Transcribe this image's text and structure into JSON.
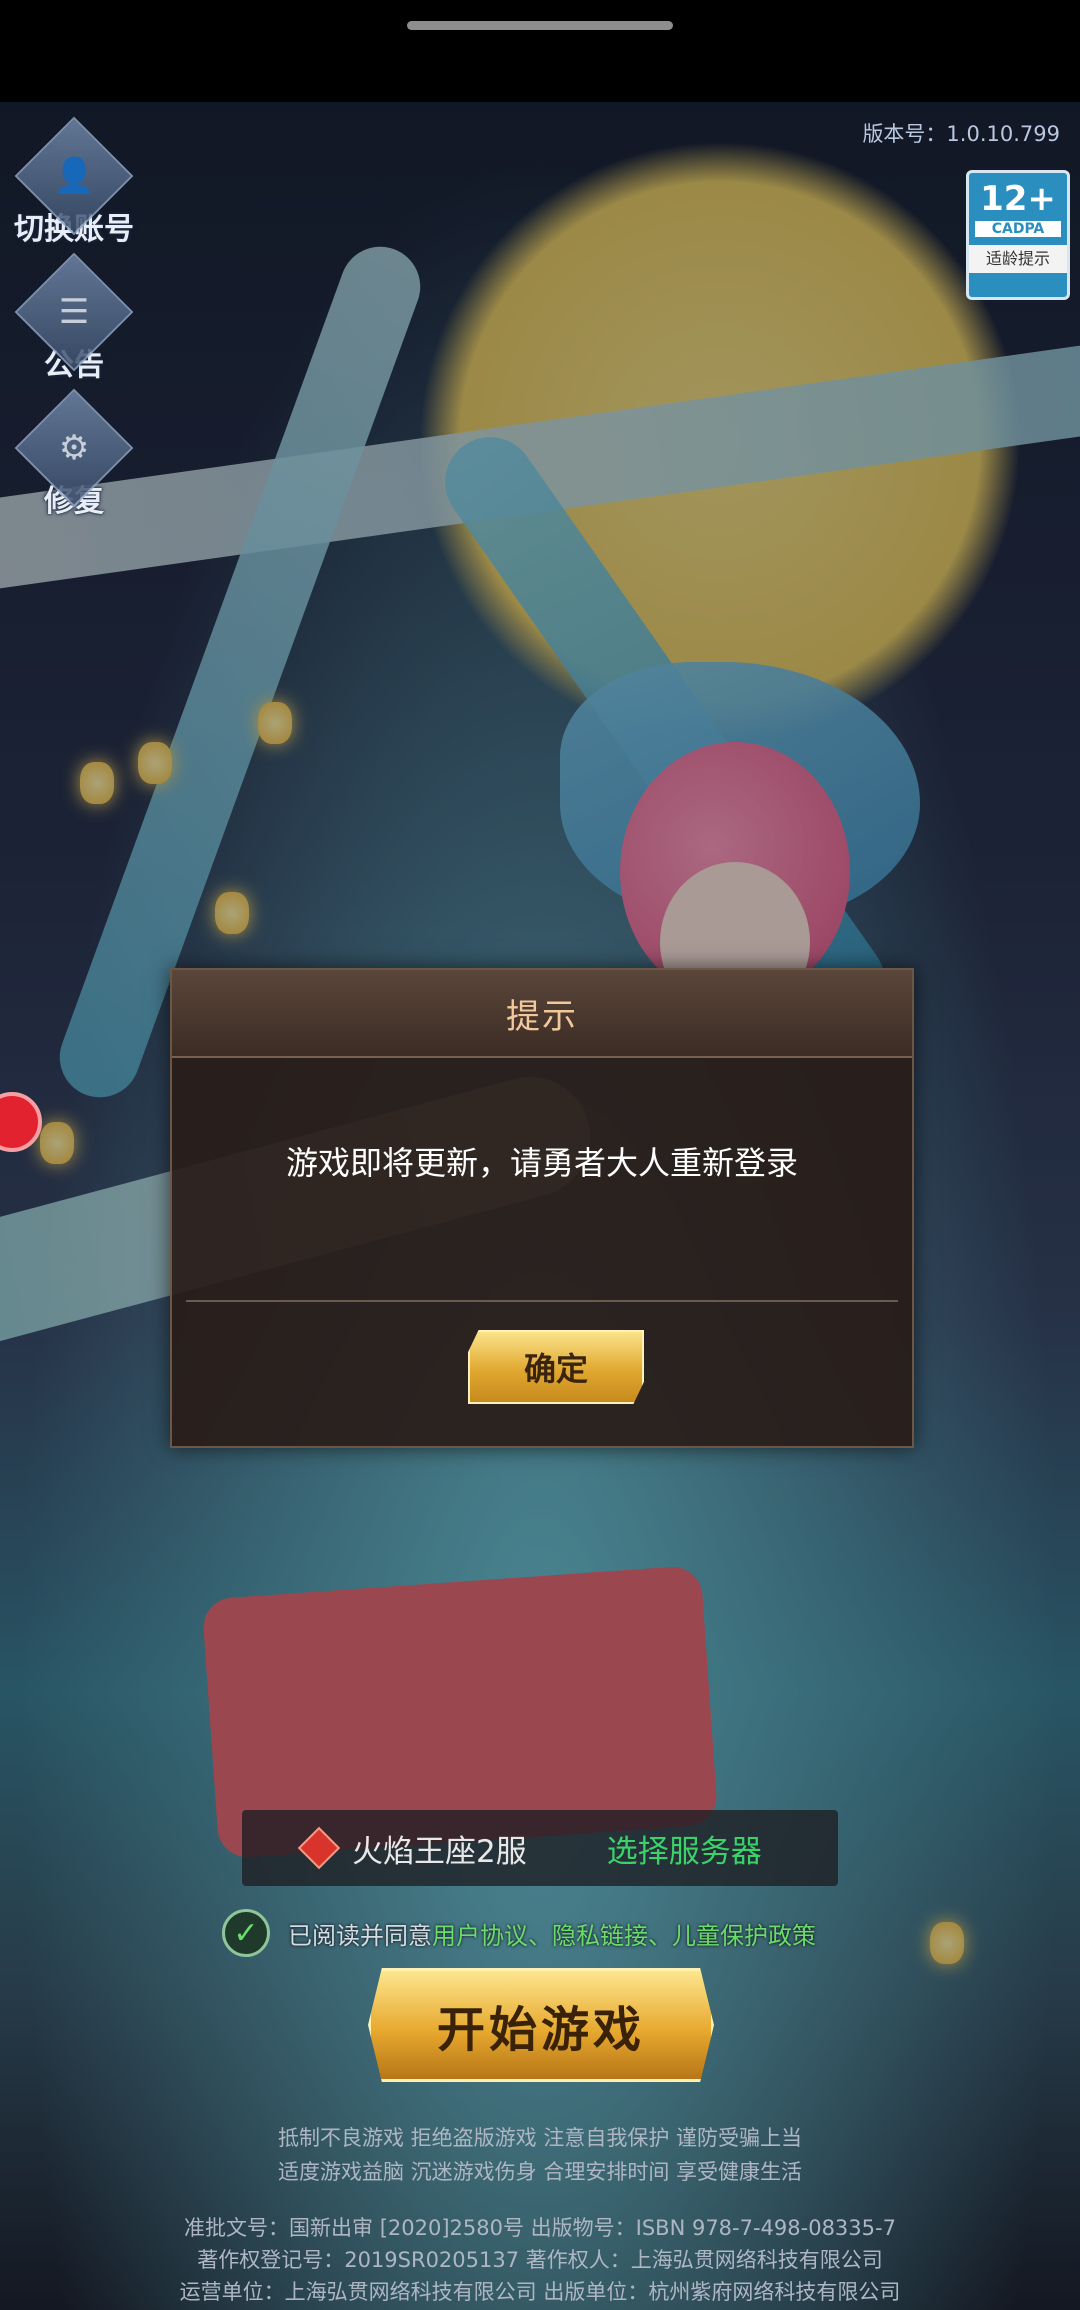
{
  "side_menu": {
    "switch_account": "切换账号",
    "notice": "公告",
    "repair": "修复"
  },
  "version_label": "版本号：1.0.10.799",
  "age_rating": {
    "age": "12+",
    "org": "CADPA",
    "hint": "适龄提示"
  },
  "dialog": {
    "title": "提示",
    "message": "游戏即将更新，请勇者大人重新登录",
    "confirm": "确定"
  },
  "server": {
    "name": "火焰王座2服",
    "select_label": "选择服务器"
  },
  "agreement": {
    "prefix": "已阅读并同意",
    "user_agreement": "用户协议",
    "sep1": "、",
    "privacy": "隐私链接",
    "sep2": "、",
    "child_protection": "儿童保护政策"
  },
  "start_button": "开始游戏",
  "footer": {
    "line1": "抵制不良游戏 拒绝盗版游戏 注意自我保护 谨防受骗上当",
    "line2": "适度游戏益脑 沉迷游戏伤身 合理安排时间 享受健康生活",
    "line3": "准批文号：国新出审 [2020]2580号 出版物号：ISBN 978-7-498-08335-7",
    "line4": "著作权登记号：2019SR0205137 著作权人：上海弘贯网络科技有限公司",
    "line5": "运营单位：上海弘贯网络科技有限公司 出版单位：杭州紫府网络科技有限公司"
  }
}
